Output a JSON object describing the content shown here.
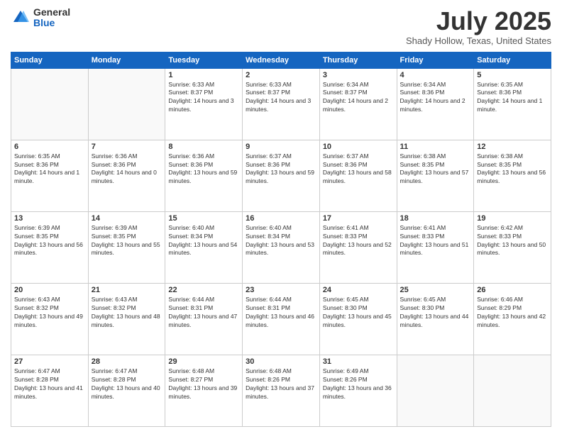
{
  "header": {
    "logo_general": "General",
    "logo_blue": "Blue",
    "title": "July 2025",
    "location": "Shady Hollow, Texas, United States"
  },
  "days_of_week": [
    "Sunday",
    "Monday",
    "Tuesday",
    "Wednesday",
    "Thursday",
    "Friday",
    "Saturday"
  ],
  "weeks": [
    [
      {
        "day": "",
        "sunrise": "",
        "sunset": "",
        "daylight": ""
      },
      {
        "day": "",
        "sunrise": "",
        "sunset": "",
        "daylight": ""
      },
      {
        "day": "1",
        "sunrise": "Sunrise: 6:33 AM",
        "sunset": "Sunset: 8:37 PM",
        "daylight": "Daylight: 14 hours and 3 minutes."
      },
      {
        "day": "2",
        "sunrise": "Sunrise: 6:33 AM",
        "sunset": "Sunset: 8:37 PM",
        "daylight": "Daylight: 14 hours and 3 minutes."
      },
      {
        "day": "3",
        "sunrise": "Sunrise: 6:34 AM",
        "sunset": "Sunset: 8:37 PM",
        "daylight": "Daylight: 14 hours and 2 minutes."
      },
      {
        "day": "4",
        "sunrise": "Sunrise: 6:34 AM",
        "sunset": "Sunset: 8:36 PM",
        "daylight": "Daylight: 14 hours and 2 minutes."
      },
      {
        "day": "5",
        "sunrise": "Sunrise: 6:35 AM",
        "sunset": "Sunset: 8:36 PM",
        "daylight": "Daylight: 14 hours and 1 minute."
      }
    ],
    [
      {
        "day": "6",
        "sunrise": "Sunrise: 6:35 AM",
        "sunset": "Sunset: 8:36 PM",
        "daylight": "Daylight: 14 hours and 1 minute."
      },
      {
        "day": "7",
        "sunrise": "Sunrise: 6:36 AM",
        "sunset": "Sunset: 8:36 PM",
        "daylight": "Daylight: 14 hours and 0 minutes."
      },
      {
        "day": "8",
        "sunrise": "Sunrise: 6:36 AM",
        "sunset": "Sunset: 8:36 PM",
        "daylight": "Daylight: 13 hours and 59 minutes."
      },
      {
        "day": "9",
        "sunrise": "Sunrise: 6:37 AM",
        "sunset": "Sunset: 8:36 PM",
        "daylight": "Daylight: 13 hours and 59 minutes."
      },
      {
        "day": "10",
        "sunrise": "Sunrise: 6:37 AM",
        "sunset": "Sunset: 8:36 PM",
        "daylight": "Daylight: 13 hours and 58 minutes."
      },
      {
        "day": "11",
        "sunrise": "Sunrise: 6:38 AM",
        "sunset": "Sunset: 8:35 PM",
        "daylight": "Daylight: 13 hours and 57 minutes."
      },
      {
        "day": "12",
        "sunrise": "Sunrise: 6:38 AM",
        "sunset": "Sunset: 8:35 PM",
        "daylight": "Daylight: 13 hours and 56 minutes."
      }
    ],
    [
      {
        "day": "13",
        "sunrise": "Sunrise: 6:39 AM",
        "sunset": "Sunset: 8:35 PM",
        "daylight": "Daylight: 13 hours and 56 minutes."
      },
      {
        "day": "14",
        "sunrise": "Sunrise: 6:39 AM",
        "sunset": "Sunset: 8:35 PM",
        "daylight": "Daylight: 13 hours and 55 minutes."
      },
      {
        "day": "15",
        "sunrise": "Sunrise: 6:40 AM",
        "sunset": "Sunset: 8:34 PM",
        "daylight": "Daylight: 13 hours and 54 minutes."
      },
      {
        "day": "16",
        "sunrise": "Sunrise: 6:40 AM",
        "sunset": "Sunset: 8:34 PM",
        "daylight": "Daylight: 13 hours and 53 minutes."
      },
      {
        "day": "17",
        "sunrise": "Sunrise: 6:41 AM",
        "sunset": "Sunset: 8:33 PM",
        "daylight": "Daylight: 13 hours and 52 minutes."
      },
      {
        "day": "18",
        "sunrise": "Sunrise: 6:41 AM",
        "sunset": "Sunset: 8:33 PM",
        "daylight": "Daylight: 13 hours and 51 minutes."
      },
      {
        "day": "19",
        "sunrise": "Sunrise: 6:42 AM",
        "sunset": "Sunset: 8:33 PM",
        "daylight": "Daylight: 13 hours and 50 minutes."
      }
    ],
    [
      {
        "day": "20",
        "sunrise": "Sunrise: 6:43 AM",
        "sunset": "Sunset: 8:32 PM",
        "daylight": "Daylight: 13 hours and 49 minutes."
      },
      {
        "day": "21",
        "sunrise": "Sunrise: 6:43 AM",
        "sunset": "Sunset: 8:32 PM",
        "daylight": "Daylight: 13 hours and 48 minutes."
      },
      {
        "day": "22",
        "sunrise": "Sunrise: 6:44 AM",
        "sunset": "Sunset: 8:31 PM",
        "daylight": "Daylight: 13 hours and 47 minutes."
      },
      {
        "day": "23",
        "sunrise": "Sunrise: 6:44 AM",
        "sunset": "Sunset: 8:31 PM",
        "daylight": "Daylight: 13 hours and 46 minutes."
      },
      {
        "day": "24",
        "sunrise": "Sunrise: 6:45 AM",
        "sunset": "Sunset: 8:30 PM",
        "daylight": "Daylight: 13 hours and 45 minutes."
      },
      {
        "day": "25",
        "sunrise": "Sunrise: 6:45 AM",
        "sunset": "Sunset: 8:30 PM",
        "daylight": "Daylight: 13 hours and 44 minutes."
      },
      {
        "day": "26",
        "sunrise": "Sunrise: 6:46 AM",
        "sunset": "Sunset: 8:29 PM",
        "daylight": "Daylight: 13 hours and 42 minutes."
      }
    ],
    [
      {
        "day": "27",
        "sunrise": "Sunrise: 6:47 AM",
        "sunset": "Sunset: 8:28 PM",
        "daylight": "Daylight: 13 hours and 41 minutes."
      },
      {
        "day": "28",
        "sunrise": "Sunrise: 6:47 AM",
        "sunset": "Sunset: 8:28 PM",
        "daylight": "Daylight: 13 hours and 40 minutes."
      },
      {
        "day": "29",
        "sunrise": "Sunrise: 6:48 AM",
        "sunset": "Sunset: 8:27 PM",
        "daylight": "Daylight: 13 hours and 39 minutes."
      },
      {
        "day": "30",
        "sunrise": "Sunrise: 6:48 AM",
        "sunset": "Sunset: 8:26 PM",
        "daylight": "Daylight: 13 hours and 37 minutes."
      },
      {
        "day": "31",
        "sunrise": "Sunrise: 6:49 AM",
        "sunset": "Sunset: 8:26 PM",
        "daylight": "Daylight: 13 hours and 36 minutes."
      },
      {
        "day": "",
        "sunrise": "",
        "sunset": "",
        "daylight": ""
      },
      {
        "day": "",
        "sunrise": "",
        "sunset": "",
        "daylight": ""
      }
    ]
  ]
}
